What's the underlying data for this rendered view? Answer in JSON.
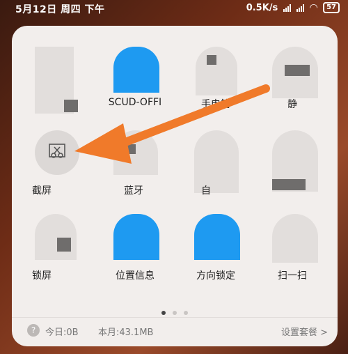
{
  "status": {
    "time": "5月12日 周四 下午",
    "speed": "0.5K/s",
    "wifi_icon": "wifi-icon",
    "battery": "57"
  },
  "tiles": [
    {
      "label": "",
      "icon": "blurred-icon"
    },
    {
      "label": "SCUD-OFFI",
      "icon": "blurred-icon"
    },
    {
      "label": "手电筒",
      "icon": "blurred-icon"
    },
    {
      "label": "静",
      "icon": "blurred-icon"
    },
    {
      "label": "截屏",
      "icon": "screenshot-icon"
    },
    {
      "label": "蓝牙",
      "icon": "blurred-icon"
    },
    {
      "label": "自",
      "icon": "blurred-icon"
    },
    {
      "label": "",
      "icon": "blurred-icon"
    },
    {
      "label": "锁屏",
      "icon": "blurred-icon"
    },
    {
      "label": "位置信息",
      "icon": "blurred-icon"
    },
    {
      "label": "方向锁定",
      "icon": "blurred-icon"
    },
    {
      "label": "扫一扫",
      "icon": "blurred-icon"
    }
  ],
  "footer": {
    "help": "?",
    "today": "今日:0B",
    "month": "本月:43.1MB",
    "settings": "设置套餐 >"
  },
  "colors": {
    "accent_blue": "#1e9af1",
    "arrow": "#f07a2a",
    "panel": "#f2eeec"
  }
}
